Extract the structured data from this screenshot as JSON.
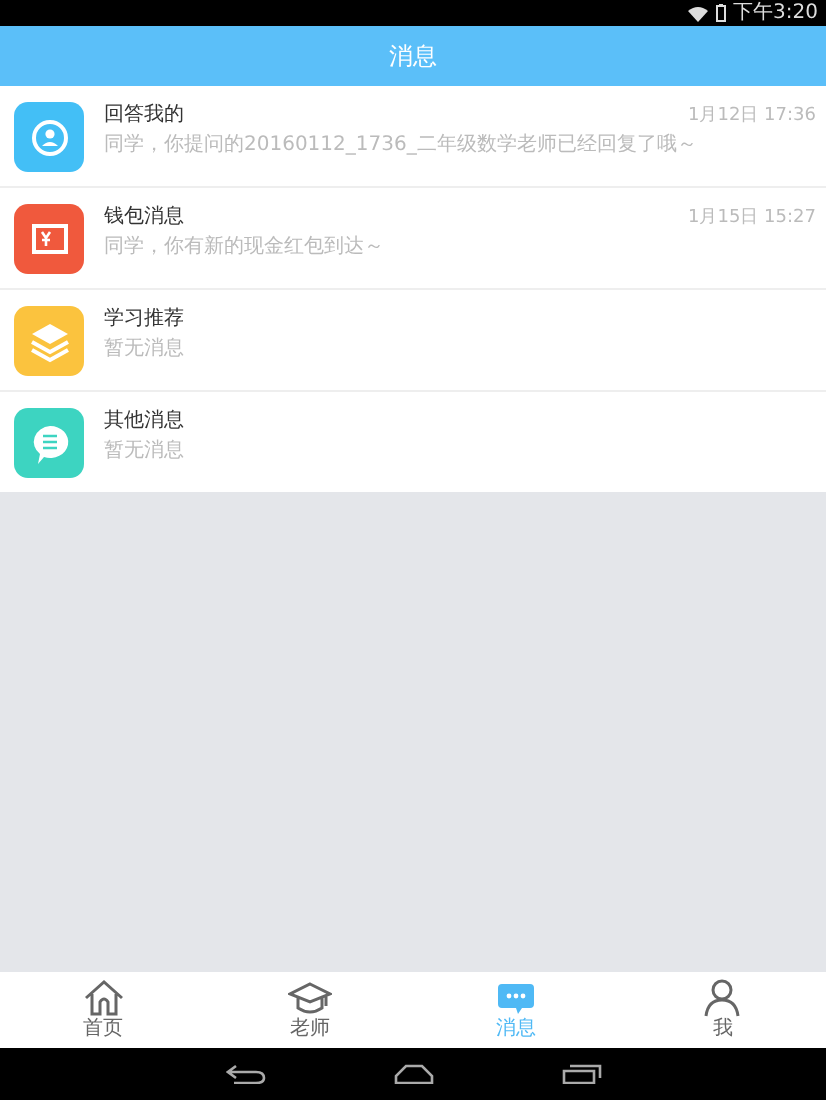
{
  "status_bar": {
    "time": "下午3:20"
  },
  "header": {
    "title": "消息"
  },
  "messages": [
    {
      "kind": "answer",
      "title": "回答我的",
      "preview": "同学，你提问的20160112_1736_二年级数学老师已经回复了哦～",
      "time": "1月12日 17:36"
    },
    {
      "kind": "wallet",
      "title": "钱包消息",
      "preview": "同学，你有新的现金红包到达～",
      "time": "1月15日 15:27"
    },
    {
      "kind": "study",
      "title": "学习推荐",
      "preview": "暂无消息"
    },
    {
      "kind": "other",
      "title": "其他消息",
      "preview": "暂无消息"
    }
  ],
  "tabs": [
    {
      "kind": "home",
      "label": "首页",
      "selected": false
    },
    {
      "kind": "teacher",
      "label": "老师",
      "selected": false
    },
    {
      "kind": "messages",
      "label": "消息",
      "selected": true
    },
    {
      "kind": "me",
      "label": "我",
      "selected": false
    }
  ]
}
